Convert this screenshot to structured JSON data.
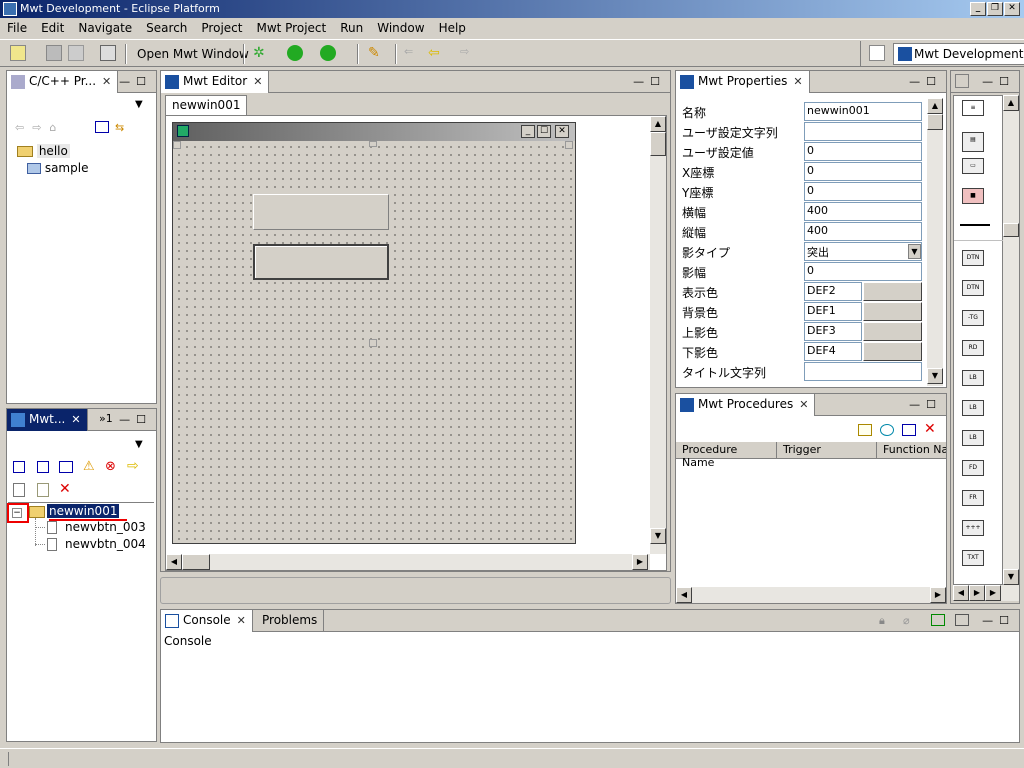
{
  "window": {
    "title": "Mwt Development - Eclipse Platform"
  },
  "menu": [
    "File",
    "Edit",
    "Navigate",
    "Search",
    "Project",
    "Mwt Project",
    "Run",
    "Window",
    "Help"
  ],
  "toolbar": {
    "open_mwt_window": "Open Mwt Window"
  },
  "perspective": {
    "label": "Mwt Development"
  },
  "cpp_projects": {
    "tab": "C/C++ Pr...",
    "items": [
      "hello",
      "sample"
    ]
  },
  "mwt_tree": {
    "tab": "Mwt...",
    "overflow": "»1",
    "root": "newwin001",
    "children": [
      "newvbtn_003",
      "newvbtn_004"
    ]
  },
  "editor": {
    "tab": "Mwt Editor",
    "subtab": "newwin001"
  },
  "properties": {
    "tab": "Mwt Properties",
    "rows": [
      {
        "k": "名称",
        "v": "newwin001"
      },
      {
        "k": "ユーザ設定文字列",
        "v": ""
      },
      {
        "k": "ユーザ設定値",
        "v": "0"
      },
      {
        "k": "X座標",
        "v": "0"
      },
      {
        "k": "Y座標",
        "v": "0"
      },
      {
        "k": "横幅",
        "v": "400"
      },
      {
        "k": "縦幅",
        "v": "400"
      },
      {
        "k": "影タイプ",
        "v": "突出"
      },
      {
        "k": "影幅",
        "v": "0"
      },
      {
        "k": "表示色",
        "v": "DEF2"
      },
      {
        "k": "背景色",
        "v": "DEF1"
      },
      {
        "k": "上影色",
        "v": "DEF3"
      },
      {
        "k": "下影色",
        "v": "DEF4"
      },
      {
        "k": "タイトル文字列",
        "v": ""
      }
    ]
  },
  "procedures": {
    "tab": "Mwt Procedures",
    "columns": [
      "Procedure Name",
      "Trigger",
      "Function Na"
    ]
  },
  "console": {
    "tab": "Console",
    "tab2": "Problems",
    "label": "Console"
  },
  "palette": [
    "DTN",
    "DTN",
    "-TG",
    "RD",
    "LB",
    "LB",
    "LB",
    "FD",
    "FR",
    "+++",
    "TXT"
  ],
  "colors": {
    "title_start": "#0a246a",
    "title_end": "#a6caf0",
    "highlight": "#0a246a",
    "bg": "#d4d0c8"
  }
}
